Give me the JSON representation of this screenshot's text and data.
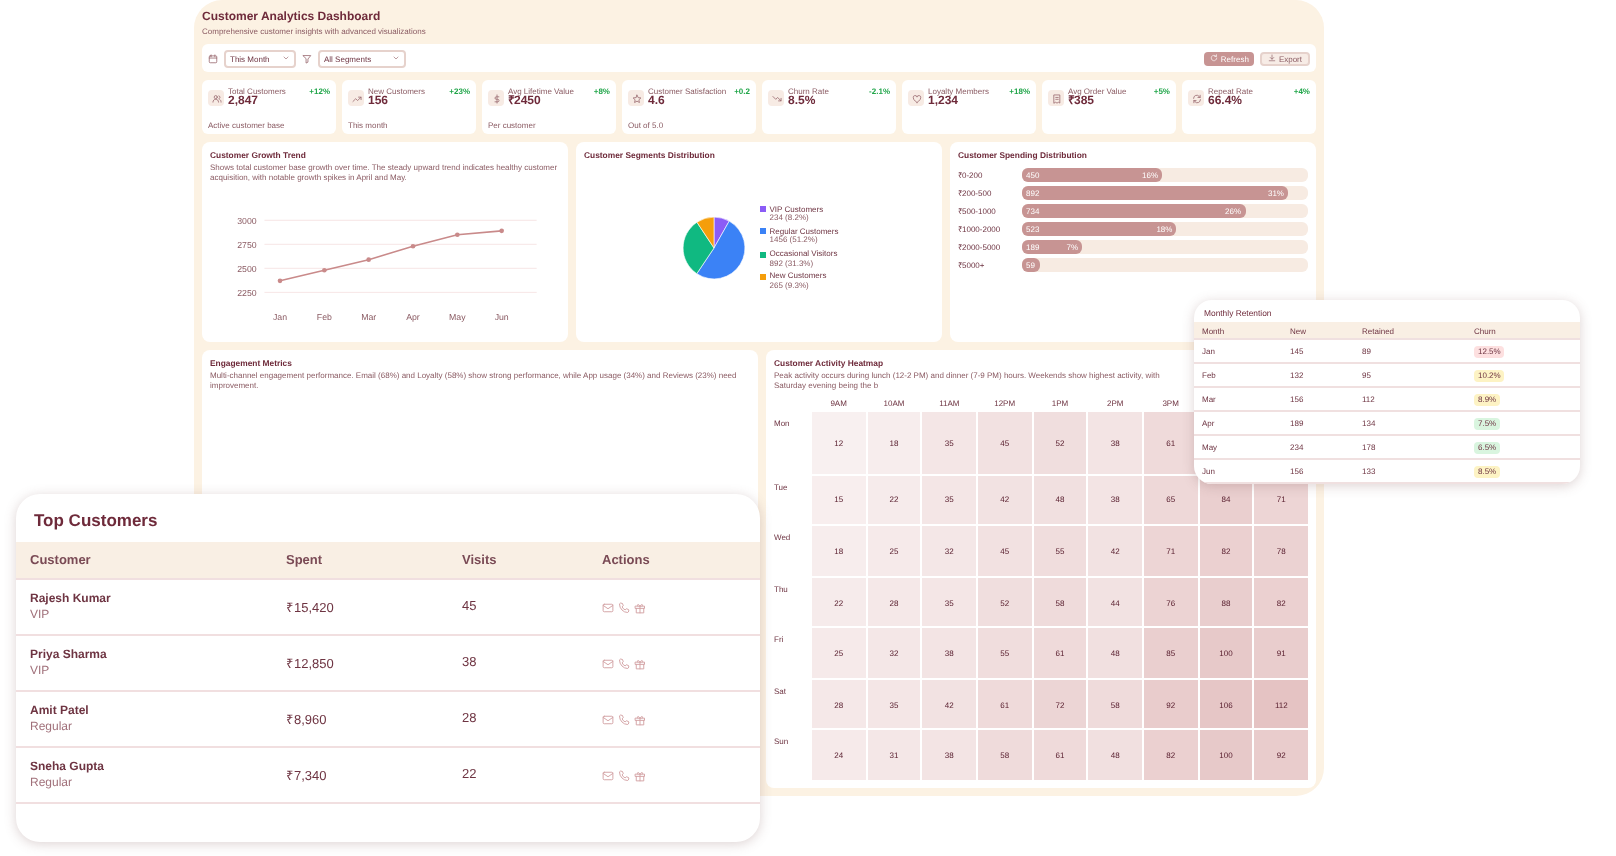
{
  "header": {
    "title": "Customer Analytics Dashboard",
    "subtitle": "Comprehensive customer insights with advanced visualizations"
  },
  "filters": {
    "period": "This Month",
    "segment": "All Segments"
  },
  "actions": [
    {
      "label": "Refresh",
      "kind": "primary"
    },
    {
      "label": "Export",
      "kind": "secondary"
    }
  ],
  "kpis": [
    {
      "kind": "users",
      "label": "Total Customers",
      "value": "2,847",
      "change": "+12%",
      "note": "Active customer base"
    },
    {
      "kind": "trend",
      "label": "New Customers",
      "value": "156",
      "change": "+23%",
      "note": "This month"
    },
    {
      "kind": "dollar",
      "label": "Avg Lifetime Value",
      "value": "₹2450",
      "change": "+8%",
      "note": "Per customer"
    },
    {
      "kind": "star",
      "label": "Customer Satisfaction",
      "value": "4.6",
      "change": "+0.2",
      "note": "Out of 5.0"
    },
    {
      "kind": "down",
      "label": "Churn Rate",
      "value": "8.5%",
      "change": "-2.1%"
    },
    {
      "kind": "heart",
      "label": "Loyalty Members",
      "value": "1,234",
      "change": "+18%"
    },
    {
      "kind": "receipt",
      "label": "Avg Order Value",
      "value": "₹385",
      "change": "+5%"
    },
    {
      "kind": "repeat",
      "label": "Repeat Rate",
      "value": "66.4%",
      "change": "+4%"
    }
  ],
  "growth": {
    "title": "Customer Growth Trend",
    "subtitle": "Shows total customer base growth over time. The steady upward trend indicates healthy customer acquisition, with notable growth spikes in April and May.",
    "chart_data": {
      "type": "line",
      "categories": [
        "Jan",
        "Feb",
        "Mar",
        "Apr",
        "May",
        "Jun"
      ],
      "ylim": [
        2200,
        3050
      ],
      "yticks": [
        2250,
        2500,
        2750,
        3000
      ],
      "series": [
        {
          "color": "#c98a8a",
          "values": [
            2370,
            2480,
            2590,
            2730,
            2850,
            2890
          ]
        }
      ]
    }
  },
  "segments": {
    "title": "Customer Segments Distribution",
    "chart_data": {
      "type": "pie",
      "categories": [
        "VIP Customers",
        "Regular Customers",
        "Occasional Visitors",
        "New Customers"
      ],
      "series": [
        {
          "values": [
            8.2,
            51.2,
            31.3,
            9.3
          ]
        }
      ]
    },
    "legend": [
      {
        "detail": "234 (8.2%)",
        "color": "#8b5cf6"
      },
      {
        "detail": "1456 (51.2%)",
        "color": "#3b82f6"
      },
      {
        "detail": "892 (31.3%)",
        "color": "#10b981"
      },
      {
        "detail": "265 (9.3%)",
        "color": "#f59e0b"
      }
    ]
  },
  "spending": {
    "title": "Customer Spending Distribution",
    "bars": [
      {
        "range": "₹0-200",
        "count": "450",
        "share": "16%",
        "level": 0.49
      },
      {
        "range": "₹200-500",
        "count": "892",
        "share": "31%",
        "level": 0.93
      },
      {
        "range": "₹500-1000",
        "count": "734",
        "share": "26%",
        "level": 0.78
      },
      {
        "range": "₹1000-2000",
        "count": "523",
        "share": "18%",
        "level": 0.54
      },
      {
        "range": "₹2000-5000",
        "count": "189",
        "share": "7%",
        "level": 0.21
      },
      {
        "range": "₹5000+",
        "count": "59",
        "level": 0.06
      }
    ]
  },
  "engagement": {
    "title": "Engagement Metrics",
    "subtitle": "Multi-channel engagement performance. Email (68%) and Loyalty (58%) show strong performance, while App usage (34%) and Reviews (23%) need improvement."
  },
  "heatmap": {
    "title": "Customer Activity Heatmap",
    "subtitle": "Peak activity occurs during lunch (12-2 PM) and dinner (7-9 PM) hours. Weekends show highest activity, with Saturday evening being the b",
    "hours": [
      "9AM",
      "10AM",
      "11AM",
      "12PM",
      "1PM",
      "2PM",
      "3PM"
    ],
    "days": [
      {
        "day": "Mon",
        "cells": [
          "12",
          "18",
          "35",
          "45",
          "52",
          "38",
          "61"
        ]
      },
      {
        "day": "Tue",
        "cells": [
          "15",
          "22",
          "35",
          "42",
          "48",
          "38",
          "65",
          "84",
          "71"
        ]
      },
      {
        "day": "Wed",
        "cells": [
          "18",
          "25",
          "32",
          "45",
          "55",
          "42",
          "71",
          "82",
          "78"
        ]
      },
      {
        "day": "Thu",
        "cells": [
          "22",
          "28",
          "35",
          "52",
          "58",
          "44",
          "76",
          "88",
          "82"
        ]
      },
      {
        "day": "Fri",
        "cells": [
          "25",
          "32",
          "38",
          "55",
          "61",
          "48",
          "85",
          "100",
          "91"
        ]
      },
      {
        "day": "Sat",
        "cells": [
          "28",
          "35",
          "42",
          "61",
          "72",
          "58",
          "92",
          "106",
          "112"
        ]
      },
      {
        "day": "Sun",
        "cells": [
          "24",
          "31",
          "38",
          "58",
          "61",
          "48",
          "82",
          "100",
          "92"
        ]
      }
    ]
  },
  "retention": {
    "title": "Monthly Retention",
    "columns": [
      "Month",
      "New",
      "Retained",
      "Churn"
    ],
    "rows": [
      {
        "month": "Jan",
        "new": "145",
        "retained": "89",
        "churn": "12.5%",
        "color": "#fde0e0"
      },
      {
        "month": "Feb",
        "new": "132",
        "retained": "95",
        "churn": "10.2%",
        "color": "#fdf3c4"
      },
      {
        "month": "Mar",
        "new": "156",
        "retained": "112",
        "churn": "8.9%",
        "color": "#fdf3c4"
      },
      {
        "month": "Apr",
        "new": "189",
        "retained": "134",
        "churn": "7.5%",
        "color": "#d9f5df"
      },
      {
        "month": "May",
        "new": "234",
        "retained": "178",
        "churn": "6.5%",
        "color": "#d9f5df"
      },
      {
        "month": "Jun",
        "new": "156",
        "retained": "133",
        "churn": "8.5%",
        "color": "#fdf3c4"
      }
    ]
  },
  "top_customers": {
    "title": "Top Customers",
    "columns": [
      "Customer",
      "Spent",
      "Visits",
      "Actions"
    ],
    "rows": [
      {
        "name": "Rajesh Kumar",
        "tier": "VIP",
        "spent": "₹15,420",
        "visits": "45"
      },
      {
        "name": "Priya Sharma",
        "tier": "VIP",
        "spent": "₹12,850",
        "visits": "38"
      },
      {
        "name": "Amit Patel",
        "tier": "Regular",
        "spent": "₹8,960",
        "visits": "28"
      },
      {
        "name": "Sneha Gupta",
        "tier": "Regular",
        "spent": "₹7,340",
        "visits": "22"
      }
    ]
  }
}
